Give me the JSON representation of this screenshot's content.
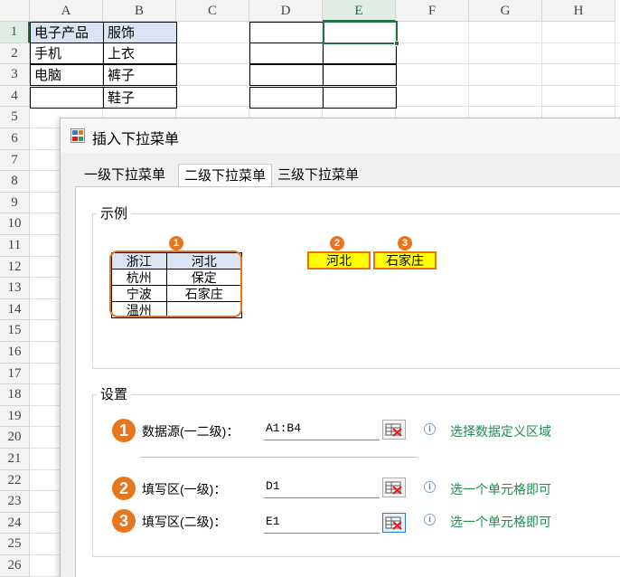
{
  "spreadsheet": {
    "columns": [
      "A",
      "B",
      "C",
      "D",
      "E",
      "F",
      "G",
      "H"
    ],
    "rows": [
      "1",
      "2",
      "3",
      "4",
      "5",
      "6",
      "7",
      "8",
      "9",
      "10",
      "11",
      "12",
      "13",
      "14",
      "15",
      "16",
      "17",
      "18",
      "19",
      "20",
      "21",
      "22",
      "23",
      "24",
      "25",
      "26"
    ],
    "cells": {
      "A1": "电子产品",
      "B1": "服饰",
      "A2": "手机",
      "B2": "上衣",
      "A3": "电脑",
      "B3": "裤子",
      "B4": "鞋子"
    },
    "selected_cell": "E1"
  },
  "dialog": {
    "title": "插入下拉菜单",
    "tabs": [
      {
        "label": "一级下拉菜单"
      },
      {
        "label": "二级下拉菜单",
        "active": true
      },
      {
        "label": "三级下拉菜单"
      }
    ],
    "example": {
      "title": "示例",
      "table": [
        [
          "浙江",
          "河北"
        ],
        [
          "杭州",
          "保定"
        ],
        [
          "宁波",
          "石家庄"
        ],
        [
          "温州",
          ""
        ]
      ],
      "badges": [
        "1",
        "2",
        "3"
      ],
      "dropdown_level1": "河北",
      "dropdown_level2": "石家庄"
    },
    "settings": {
      "title": "设置",
      "fields": [
        {
          "num": "1",
          "label": "数据源(一二级)：",
          "value": "A1:B4",
          "hint": "选择数据定义区域",
          "info_icon": "info-icon"
        },
        {
          "num": "2",
          "label": "填写区(一级)：",
          "value": "D1",
          "hint": "选一个单元格即可",
          "info_icon": "info-icon"
        },
        {
          "num": "3",
          "label": "填写区(二级)：",
          "value": "E1",
          "hint": "选一个单元格即可",
          "info_icon": "info-icon"
        }
      ]
    }
  },
  "colors": {
    "excel_green": "#217346",
    "badge_orange": "#e8761e",
    "annotation_red": "#e3141a",
    "hint_green": "#1f8c4e",
    "example_yellow": "#ffff00"
  }
}
